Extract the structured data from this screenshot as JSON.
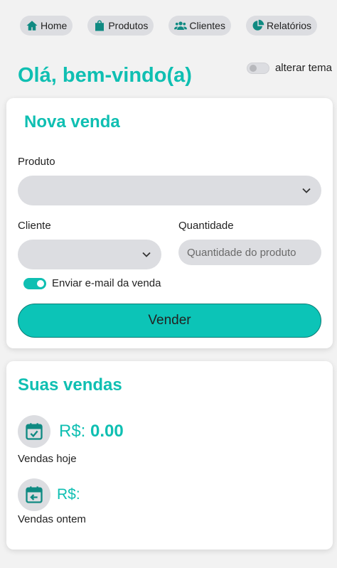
{
  "nav": {
    "items": [
      {
        "label": "Home",
        "icon": "home-icon"
      },
      {
        "label": "Produtos",
        "icon": "shopping-bag-icon"
      },
      {
        "label": "Clientes",
        "icon": "users-icon"
      },
      {
        "label": "Relatórios",
        "icon": "pie-chart-icon"
      }
    ]
  },
  "header": {
    "greeting": "Olá, bem-vindo(a)",
    "theme_toggle_label": "alterar tema",
    "theme_toggle_on": false
  },
  "new_sale": {
    "title": "Nova venda",
    "product_label": "Produto",
    "product_value": "",
    "client_label": "Cliente",
    "client_value": "",
    "quantity_label": "Quantidade",
    "quantity_placeholder": "Quantidade do produto",
    "email_toggle_label": "Enviar e-mail da venda",
    "email_toggle_on": true,
    "submit_label": "Vender"
  },
  "sales": {
    "title": "Suas vendas",
    "today": {
      "currency": "R$:",
      "amount": "0.00",
      "caption": "Vendas hoje"
    },
    "yesterday": {
      "currency": "R$:",
      "amount": "",
      "caption": "Vendas ontem"
    }
  },
  "colors": {
    "accent": "#0fbfb2",
    "button": "#0cc4b7",
    "field_bg": "#dcdde1",
    "icon": "#0f8a82"
  }
}
